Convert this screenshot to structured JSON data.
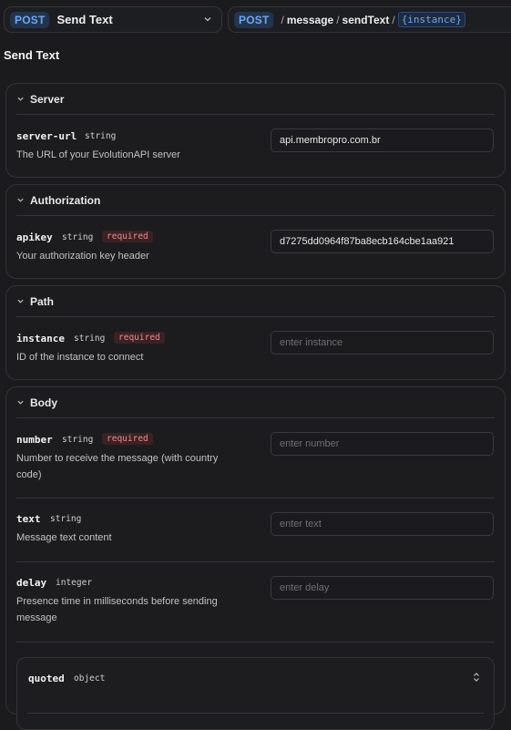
{
  "topbar": {
    "method": "POST",
    "endpoint_name": "Send Text",
    "path_method": "POST",
    "path_segments": [
      "message",
      "sendText"
    ],
    "path_param": "{instance}"
  },
  "page_title": "Send Text",
  "server": {
    "title": "Server",
    "field": {
      "name": "server-url",
      "type": "string",
      "description": "The URL of your EvolutionAPI server",
      "value": "api.membropro.com.br"
    }
  },
  "authorization": {
    "title": "Authorization",
    "field": {
      "name": "apikey",
      "type": "string",
      "required": "required",
      "description": "Your authorization key header",
      "value": "d7275dd0964f87ba8ecb164cbe1aa921"
    }
  },
  "path": {
    "title": "Path",
    "field": {
      "name": "instance",
      "type": "string",
      "required": "required",
      "description": "ID of the instance to connect",
      "placeholder": "enter instance"
    }
  },
  "body": {
    "title": "Body",
    "fields": [
      {
        "name": "number",
        "type": "string",
        "required": "required",
        "description": "Number to receive the message (with country code)",
        "placeholder": "enter number"
      },
      {
        "name": "text",
        "type": "string",
        "description": "Message text content",
        "placeholder": "enter text"
      },
      {
        "name": "delay",
        "type": "integer",
        "description": "Presence time in milliseconds before sending message",
        "placeholder": "enter delay"
      }
    ],
    "quoted": {
      "name": "quoted",
      "type": "object"
    }
  }
}
